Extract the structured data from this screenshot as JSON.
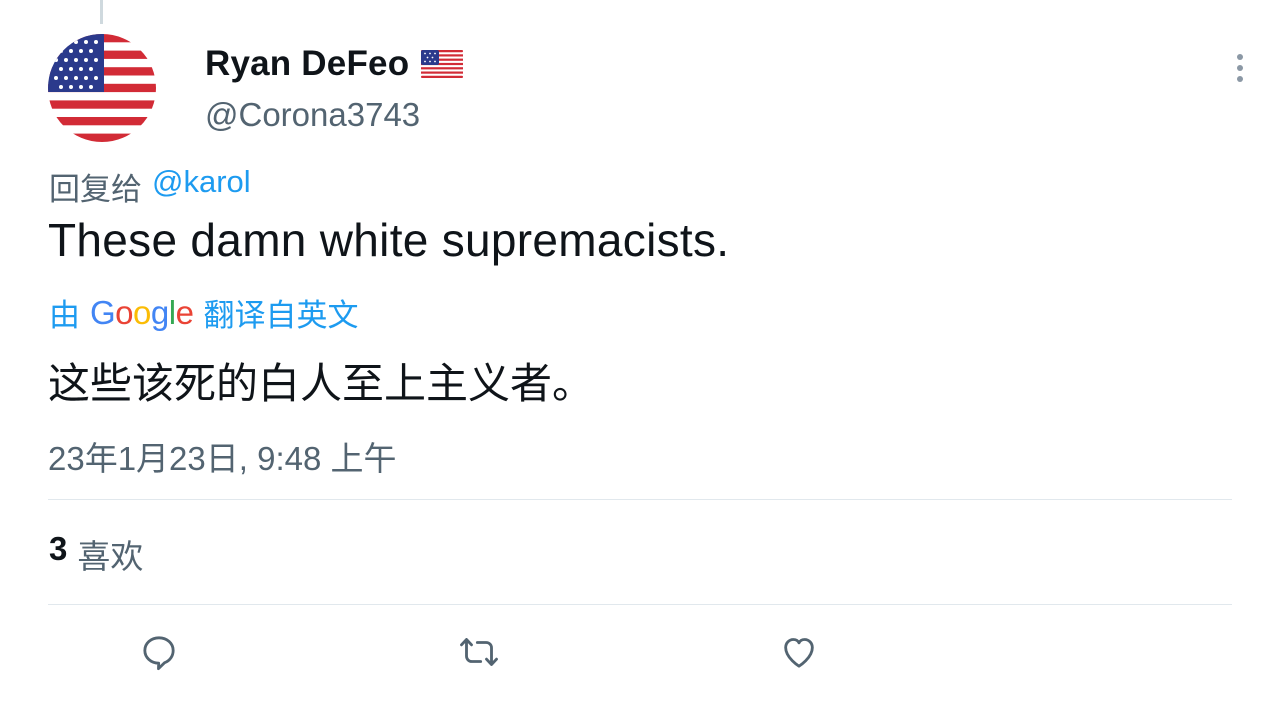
{
  "tweet": {
    "author": {
      "display_name": "Ryan DeFeo",
      "handle": "@Corona3743",
      "avatar_icon": "us-flag-avatar",
      "name_emoji_icon": "us-flag-icon"
    },
    "reply_prefix": "回复给",
    "reply_mention": "@karol",
    "text": "These damn white supremacists.",
    "translation": {
      "prefix": "由",
      "provider": "Google",
      "suffix": "翻译自英文",
      "text": "这些该死的白人至上主义者。"
    },
    "timestamp": "23年1月23日, 9:48 上午",
    "likes": {
      "count": "3",
      "label": "喜欢"
    },
    "actions": [
      {
        "name": "reply",
        "icon": "reply-icon"
      },
      {
        "name": "retweet",
        "icon": "retweet-icon"
      },
      {
        "name": "like",
        "icon": "heart-icon"
      }
    ],
    "colors": {
      "text": "#0f1419",
      "secondary": "#536471",
      "link": "#1d9bf0",
      "divider": "#e1e8ed"
    }
  }
}
